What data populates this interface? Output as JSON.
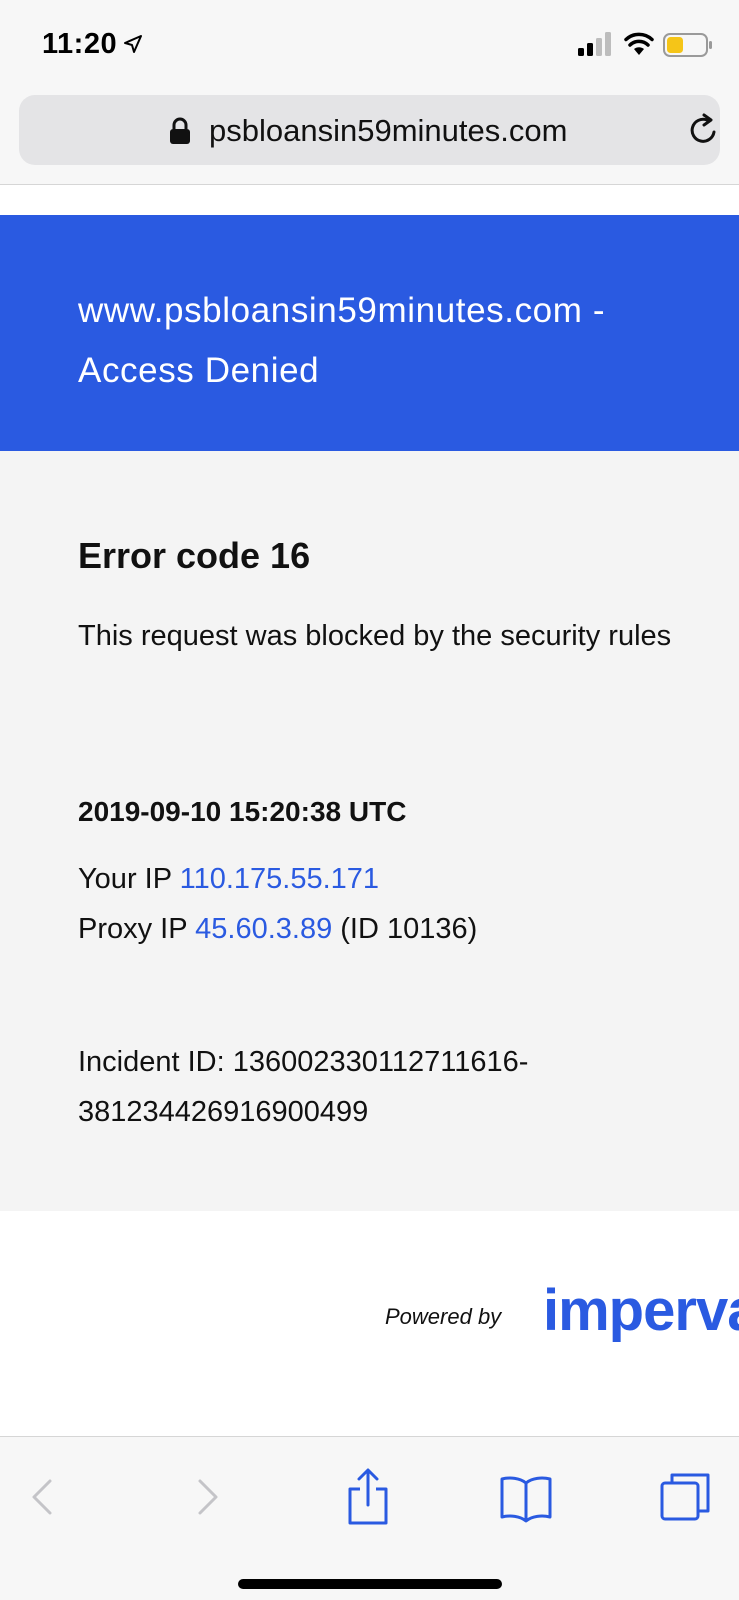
{
  "status_bar": {
    "time": "11:20",
    "icons": [
      "location-arrow-icon",
      "signal-icon",
      "wifi-icon",
      "battery-icon"
    ]
  },
  "address_bar": {
    "url": "psbloansin59minutes.com",
    "icons": [
      "lock-icon",
      "reload-icon"
    ]
  },
  "banner": {
    "title": "www.psbloansin59minutes.com - Access Denied",
    "color": "#2a5ae1"
  },
  "error": {
    "title": "Error code 16",
    "description": "This request was blocked by the security rules"
  },
  "details": {
    "timestamp": "2019-09-10 15:20:38 UTC",
    "your_ip_label": "Your IP",
    "your_ip": "110.175.55.171",
    "proxy_ip_label": "Proxy IP",
    "proxy_ip": "45.60.3.89",
    "proxy_id": "(ID 10136)",
    "incident_label": "Incident ID:",
    "incident_id": "136002330112711616-381234426916900499"
  },
  "footer": {
    "powered_by": "Powered by",
    "brand": "imperva"
  },
  "toolbar": {
    "icons": [
      "back-icon",
      "forward-icon",
      "share-icon",
      "bookmarks-icon",
      "tabs-icon"
    ]
  },
  "colors": {
    "accent": "#2a5ae1",
    "content_bg": "#f4f4f4",
    "chrome_bg": "#f7f7f7",
    "battery_level": "#f5c518"
  }
}
